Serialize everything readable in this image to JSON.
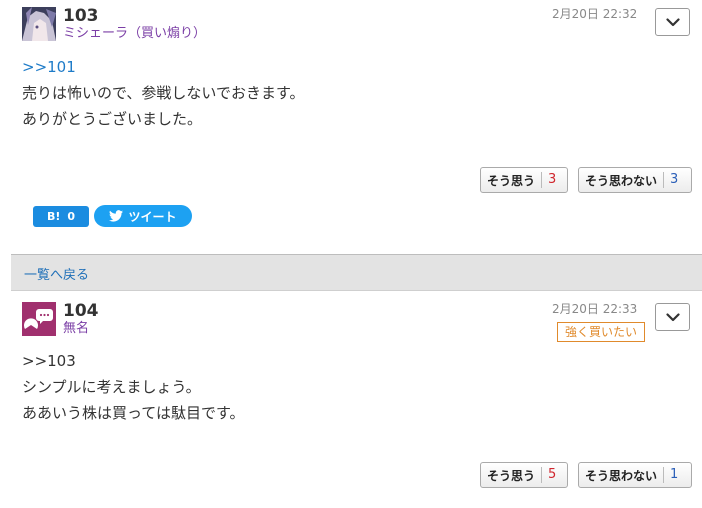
{
  "posts": [
    {
      "number": "103",
      "username": "ミシェーラ（買い煽り）",
      "date": "2月20日 22:32",
      "lines": [
        ">>101",
        "売りは怖いので、参戦しないでおきます。",
        "ありがとうございました。"
      ],
      "agree_label": "そう思う",
      "agree_count": "3",
      "disagree_label": "そう思わない",
      "disagree_count": "3",
      "avatar_icon": "character-avatar-icon"
    },
    {
      "number": "104",
      "username": "無名",
      "date": "2月20日 22:33",
      "badge": "強く買いたい",
      "lines": [
        ">>103",
        "シンプルに考えましょう。",
        "ああいう株は買っては駄目です。"
      ],
      "agree_label": "そう思う",
      "agree_count": "5",
      "disagree_label": "そう思わない",
      "disagree_count": "1",
      "avatar_icon": "chat-bubble-avatar-icon"
    }
  ],
  "share": {
    "hatena_label": "B!",
    "hatena_count": "0",
    "tweet_label": "ツイート"
  },
  "back_link": "一覧へ戻る",
  "colors": {
    "anchor": "#1e7bc8",
    "username": "#7b3fa6",
    "badge": "#e08a2c",
    "agree_count": "#d0262e",
    "disagree_count": "#2b5fb8",
    "avatar_104": "#a0306e",
    "tweet": "#1da1f2",
    "hatena": "#1b8ce0"
  }
}
